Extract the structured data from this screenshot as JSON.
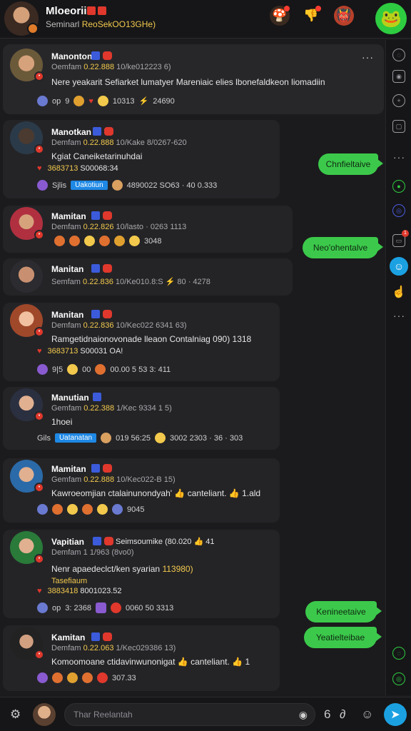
{
  "header": {
    "title": "Mloeorii",
    "subtitle_prefix": "Seminarl",
    "subtitle_code": "ReoSekOO13GHe)"
  },
  "colors": {
    "accent_green": "#3cc94b",
    "accent_blue": "#1ba1e2",
    "flag_red": "#e0382c",
    "gold": "#f2c94c"
  },
  "messages": [
    {
      "name": "Manonton",
      "meta_a": "Oemfam",
      "meta_b": "0.22.888",
      "meta_c": "10/ke012223 6)",
      "text": "Nere yeakarit Sefiarket lumatyer Mareniaic elies lbonefaldkeon liomadiin",
      "react": [
        "op",
        "9",
        "10313",
        "24690"
      ]
    },
    {
      "name": "Manotkan",
      "meta_a": "Demfam",
      "meta_b": "0.22.888",
      "meta_c": "10/Kake 8/0267-620",
      "text": "Kgiat Caneiketarinuhdai",
      "line_y": "3683713",
      "line_w": "S00068:34",
      "react_text": "Sjlis",
      "tag": "Uakotiun",
      "react_tail": "4890022 SO63 · 40 0.333"
    },
    {
      "name": "Mamitan",
      "meta_a": "Demfam",
      "meta_b": "0.22.826",
      "meta_c": "10/lasto · 0263 1113",
      "react_tail": "3048"
    },
    {
      "name": "Manitan",
      "meta_a": "Semfam",
      "meta_b": "0.22.836",
      "meta_c": "10/Ke010.8:S",
      "meta_d": "80 · 4278"
    },
    {
      "name": "Manitan",
      "meta_a": "Demfam",
      "meta_b": "0.22.836",
      "meta_c": "10/Kec022 6341 63)",
      "text": "Ramgetidnaionovonade lleaon Contalniag 090) 1318",
      "line_y": "3683713",
      "line_w": "S00031 OA!",
      "react_a": "9|5",
      "react_b": "00",
      "react_tail": "00.00 5 53 3: 411"
    },
    {
      "name": "Manutian",
      "meta_a": "Gemfam",
      "meta_b": "0.22.388",
      "meta_c": "1/Kec 9334 1 5)",
      "text": "1hoei",
      "react_text": "Gils",
      "tag": "Uatanatan",
      "react_mid": "019 56:25",
      "react_tail": "3002 2303 · 36 · 303"
    },
    {
      "name": "Mamitan",
      "meta_a": "Gemfam",
      "meta_b": "0.22.888",
      "meta_c": "10/Kec022-B 15)",
      "text": "Kawroeomjian ctalainunondyah'",
      "text_b": "canteliant.",
      "text_c": "1.ald",
      "react_tail": "9045"
    },
    {
      "name": "Vapitian",
      "meta_inline": "Seimsoumike (80.020",
      "meta_inline_b": "41",
      "meta_a": "Demfam 1",
      "meta_c": "1/963 (8vo0)",
      "text": "Nenr apaedeclct/ken syarian",
      "text_y": "113980)",
      "line_y": "Tasefiaum",
      "line_y2": "3883418",
      "line_w": "8001023.52",
      "react_a": "op",
      "react_b": "3: 2368",
      "react_tail": "0060 50 3313"
    },
    {
      "name": "Kamitan",
      "meta_a": "Demfam",
      "meta_b": "0.22.063",
      "meta_c": "1/Kec029386 13)",
      "text": "Komoomoane ctidavinwunonigat",
      "text_b": "canteliant.",
      "text_c": "1",
      "react_tail": "307.33"
    }
  ],
  "bubbles": [
    "Chnfieltaive",
    "Neo'ohentalve",
    "Kenineetaive",
    "Yeatielteibae"
  ],
  "composer": {
    "placeholder": "Thar Reelantah"
  }
}
